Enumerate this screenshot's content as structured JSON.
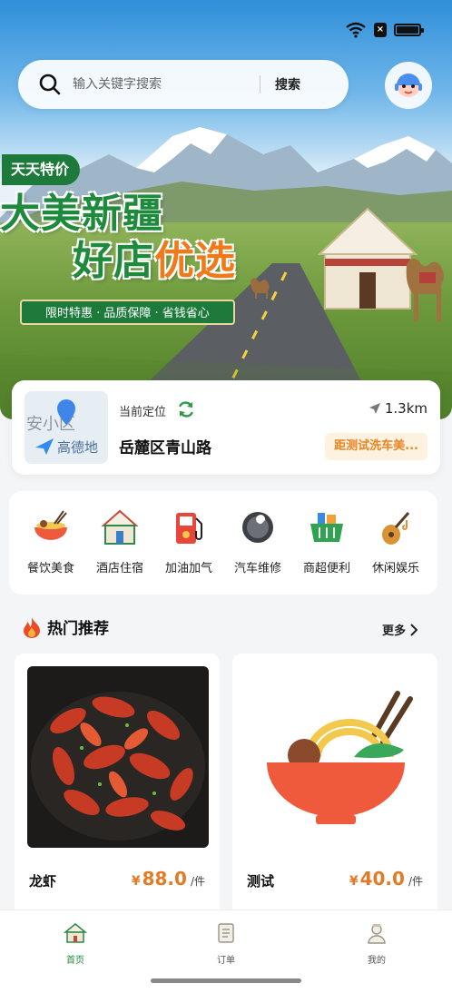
{
  "search": {
    "placeholder": "输入关键字搜索",
    "button_label": "搜索"
  },
  "banner": {
    "tag": "天天特价",
    "headline_line1": "大美新疆",
    "headline_line2_a": "好店",
    "headline_line2_b": "优选",
    "ribbon": "限时特惠 · 品质保障 · 省钱省心"
  },
  "location": {
    "map_area_text": "安小区",
    "map_logo_text": "高德地",
    "label": "当前定位",
    "distance": "1.3km",
    "address": "岳麓区青山路",
    "nearest_shop": "距测试洗车美..."
  },
  "categories": [
    {
      "label": "餐饮美食",
      "icon": "food-bowl-icon"
    },
    {
      "label": "酒店住宿",
      "icon": "yurt-icon"
    },
    {
      "label": "加油加气",
      "icon": "fuel-pump-icon"
    },
    {
      "label": "汽车维修",
      "icon": "wrench-icon"
    },
    {
      "label": "商超便利",
      "icon": "shopping-basket-icon"
    },
    {
      "label": "休闲娱乐",
      "icon": "lute-icon"
    }
  ],
  "hot": {
    "title": "热门推荐",
    "more": "更多"
  },
  "products": [
    {
      "name": "龙虾",
      "currency": "¥",
      "price": "88.0",
      "unit": "/件"
    },
    {
      "name": "测试",
      "currency": "¥",
      "price": "40.0",
      "unit": "/件"
    }
  ],
  "tabbar": [
    {
      "label": "首页",
      "active": true
    },
    {
      "label": "订单",
      "active": false
    },
    {
      "label": "我的",
      "active": false
    }
  ],
  "colors": {
    "brand_green": "#1d7a3a",
    "price_orange": "#e37b26",
    "badge_bg": "#fdf1e0"
  }
}
